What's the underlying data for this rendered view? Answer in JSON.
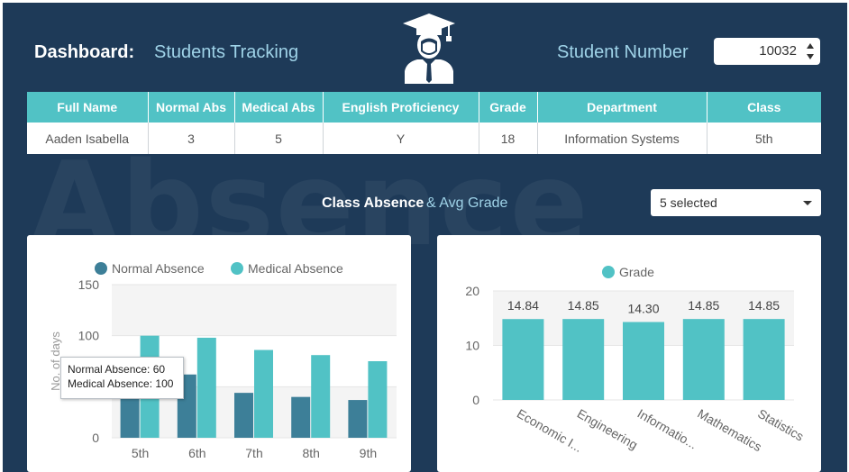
{
  "header": {
    "label": "Dashboard:",
    "title": "Students Tracking",
    "student_number_label": "Student Number",
    "student_number_value": "10032"
  },
  "table": {
    "columns": [
      "Full Name",
      "Normal Abs",
      "Medical Abs",
      "English Proficiency",
      "Grade",
      "Department",
      "Class"
    ],
    "row": [
      "Aaden Isabella",
      "3",
      "5",
      "Y",
      "18",
      "Information Systems",
      "5th"
    ]
  },
  "watermark": "Absence",
  "section": {
    "title": "Class Absence",
    "subtitle": "& Avg Grade",
    "filter_value": "5 selected"
  },
  "tooltip": {
    "line1": "Normal Absence: 60",
    "line2": "Medical Absence: 100"
  },
  "colors": {
    "background": "#1e3a58",
    "normal_absence": "#3d7f98",
    "medical_absence": "#51c2c5",
    "grade": "#51c2c5"
  },
  "chart_data": [
    {
      "type": "bar",
      "title": "",
      "xlabel": "",
      "ylabel": "No. of days",
      "categories": [
        "5th",
        "6th",
        "7th",
        "8th",
        "9th"
      ],
      "series": [
        {
          "name": "Normal Absence",
          "values": [
            60,
            62,
            44,
            40,
            37
          ]
        },
        {
          "name": "Medical Absence",
          "values": [
            100,
            98,
            86,
            81,
            75
          ]
        }
      ],
      "ylim": [
        0,
        150
      ],
      "yticks": [
        0,
        50,
        100,
        150
      ],
      "legend": "top"
    },
    {
      "type": "bar",
      "title": "",
      "xlabel": "",
      "ylabel": "",
      "categories": [
        "Economic I...",
        "Engineering",
        "Informatio...",
        "Mathematics",
        "Statistics"
      ],
      "series": [
        {
          "name": "Grade",
          "values": [
            14.84,
            14.85,
            14.3,
            14.85,
            14.85
          ]
        }
      ],
      "data_labels": [
        "14.84",
        "14.85",
        "14.30",
        "14.85",
        "14.85"
      ],
      "ylim": [
        0,
        20
      ],
      "yticks": [
        0,
        10,
        20
      ],
      "legend": "top"
    }
  ]
}
